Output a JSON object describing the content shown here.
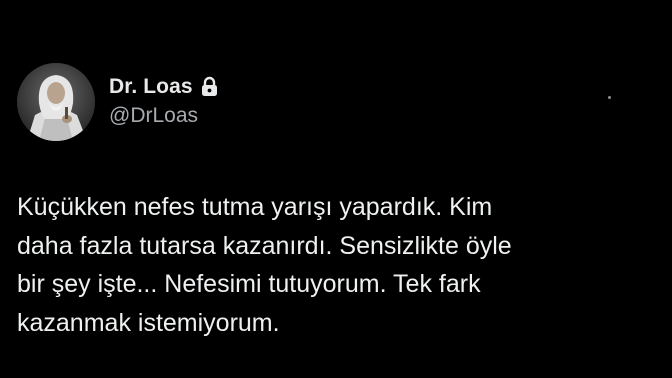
{
  "author": {
    "display_name": "Dr. Loas",
    "handle": "@DrLoas",
    "protected_icon": "lock-icon",
    "avatar": "avatar-photo"
  },
  "menu_icon": "more-options-icon",
  "tweet": {
    "lines": [
      "Küçükken nefes tutma yarışı yapardık. Kim",
      "daha fazla tutarsa kazanırdı. Sensizlikte öyle",
      "bir şey işte... Nefesimi tutuyorum. Tek fark",
      "kazanmak istemiyorum."
    ]
  },
  "colors": {
    "background": "#000000",
    "text_primary": "#e7e9ea",
    "text_secondary": "#a7abaf"
  }
}
